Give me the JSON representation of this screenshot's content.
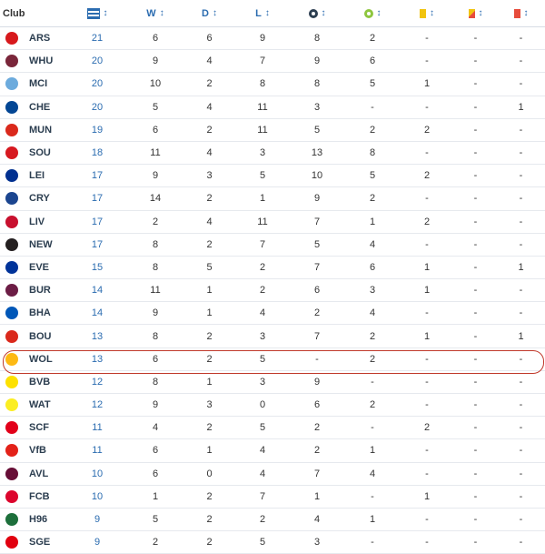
{
  "header": {
    "club_label": "Club",
    "w_label": "W",
    "d_label": "D",
    "l_label": "L",
    "sort_glyph": "↕",
    "yellow_color": "#f1c40f",
    "red_color": "#e74c3c",
    "accent": "#2b6cb0",
    "highlight_color": "#c0392b"
  },
  "rows": [
    {
      "club": "ARS",
      "logo_color": "#d7191c",
      "mp": "21",
      "w": "6",
      "d": "6",
      "l": "9",
      "g": "8",
      "a": "2",
      "y": "-",
      "yr": "-",
      "r": "-"
    },
    {
      "club": "WHU",
      "logo_color": "#7a263a",
      "mp": "20",
      "w": "9",
      "d": "4",
      "l": "7",
      "g": "9",
      "a": "6",
      "y": "-",
      "yr": "-",
      "r": "-"
    },
    {
      "club": "MCI",
      "logo_color": "#6cabdd",
      "mp": "20",
      "w": "10",
      "d": "2",
      "l": "8",
      "g": "8",
      "a": "5",
      "y": "1",
      "yr": "-",
      "r": "-"
    },
    {
      "club": "CHE",
      "logo_color": "#034694",
      "mp": "20",
      "w": "5",
      "d": "4",
      "l": "11",
      "g": "3",
      "a": "-",
      "y": "-",
      "yr": "-",
      "r": "1"
    },
    {
      "club": "MUN",
      "logo_color": "#da291c",
      "mp": "19",
      "w": "6",
      "d": "2",
      "l": "11",
      "g": "5",
      "a": "2",
      "y": "2",
      "yr": "-",
      "r": "-"
    },
    {
      "club": "SOU",
      "logo_color": "#d71920",
      "mp": "18",
      "w": "11",
      "d": "4",
      "l": "3",
      "g": "13",
      "a": "8",
      "y": "-",
      "yr": "-",
      "r": "-"
    },
    {
      "club": "LEI",
      "logo_color": "#003090",
      "mp": "17",
      "w": "9",
      "d": "3",
      "l": "5",
      "g": "10",
      "a": "5",
      "y": "2",
      "yr": "-",
      "r": "-"
    },
    {
      "club": "CRY",
      "logo_color": "#1b458f",
      "mp": "17",
      "w": "14",
      "d": "2",
      "l": "1",
      "g": "9",
      "a": "2",
      "y": "-",
      "yr": "-",
      "r": "-"
    },
    {
      "club": "LIV",
      "logo_color": "#c8102e",
      "mp": "17",
      "w": "2",
      "d": "4",
      "l": "11",
      "g": "7",
      "a": "1",
      "y": "2",
      "yr": "-",
      "r": "-"
    },
    {
      "club": "NEW",
      "logo_color": "#241f20",
      "mp": "17",
      "w": "8",
      "d": "2",
      "l": "7",
      "g": "5",
      "a": "4",
      "y": "-",
      "yr": "-",
      "r": "-"
    },
    {
      "club": "EVE",
      "logo_color": "#003399",
      "mp": "15",
      "w": "8",
      "d": "5",
      "l": "2",
      "g": "7",
      "a": "6",
      "y": "1",
      "yr": "-",
      "r": "1"
    },
    {
      "club": "BUR",
      "logo_color": "#6c1d45",
      "mp": "14",
      "w": "11",
      "d": "1",
      "l": "2",
      "g": "6",
      "a": "3",
      "y": "1",
      "yr": "-",
      "r": "-"
    },
    {
      "club": "BHA",
      "logo_color": "#0057b8",
      "mp": "14",
      "w": "9",
      "d": "1",
      "l": "4",
      "g": "2",
      "a": "4",
      "y": "-",
      "yr": "-",
      "r": "-"
    },
    {
      "club": "BOU",
      "logo_color": "#da291c",
      "mp": "13",
      "w": "8",
      "d": "2",
      "l": "3",
      "g": "7",
      "a": "2",
      "y": "1",
      "yr": "-",
      "r": "1"
    },
    {
      "club": "WOL",
      "logo_color": "#fdb913",
      "mp": "13",
      "w": "6",
      "d": "2",
      "l": "5",
      "g": "-",
      "a": "2",
      "y": "-",
      "yr": "-",
      "r": "-"
    },
    {
      "club": "BVB",
      "logo_color": "#fde100",
      "mp": "12",
      "w": "8",
      "d": "1",
      "l": "3",
      "g": "9",
      "a": "-",
      "y": "-",
      "yr": "-",
      "r": "-"
    },
    {
      "club": "WAT",
      "logo_color": "#fbee23",
      "mp": "12",
      "w": "9",
      "d": "3",
      "l": "0",
      "g": "6",
      "a": "2",
      "y": "-",
      "yr": "-",
      "r": "-"
    },
    {
      "club": "SCF",
      "logo_color": "#e2001a",
      "mp": "11",
      "w": "4",
      "d": "2",
      "l": "5",
      "g": "2",
      "a": "-",
      "y": "2",
      "yr": "-",
      "r": "-"
    },
    {
      "club": "VfB",
      "logo_color": "#e32219",
      "mp": "11",
      "w": "6",
      "d": "1",
      "l": "4",
      "g": "2",
      "a": "1",
      "y": "-",
      "yr": "-",
      "r": "-"
    },
    {
      "club": "AVL",
      "logo_color": "#670e36",
      "mp": "10",
      "w": "6",
      "d": "0",
      "l": "4",
      "g": "7",
      "a": "4",
      "y": "-",
      "yr": "-",
      "r": "-"
    },
    {
      "club": "FCB",
      "logo_color": "#dc052d",
      "mp": "10",
      "w": "1",
      "d": "2",
      "l": "7",
      "g": "1",
      "a": "-",
      "y": "1",
      "yr": "-",
      "r": "-"
    },
    {
      "club": "H96",
      "logo_color": "#1d6f3b",
      "mp": "9",
      "w": "5",
      "d": "2",
      "l": "2",
      "g": "4",
      "a": "1",
      "y": "-",
      "yr": "-",
      "r": "-"
    },
    {
      "club": "SGE",
      "logo_color": "#e1000f",
      "mp": "9",
      "w": "2",
      "d": "2",
      "l": "5",
      "g": "3",
      "a": "-",
      "y": "-",
      "yr": "-",
      "r": "-"
    }
  ]
}
